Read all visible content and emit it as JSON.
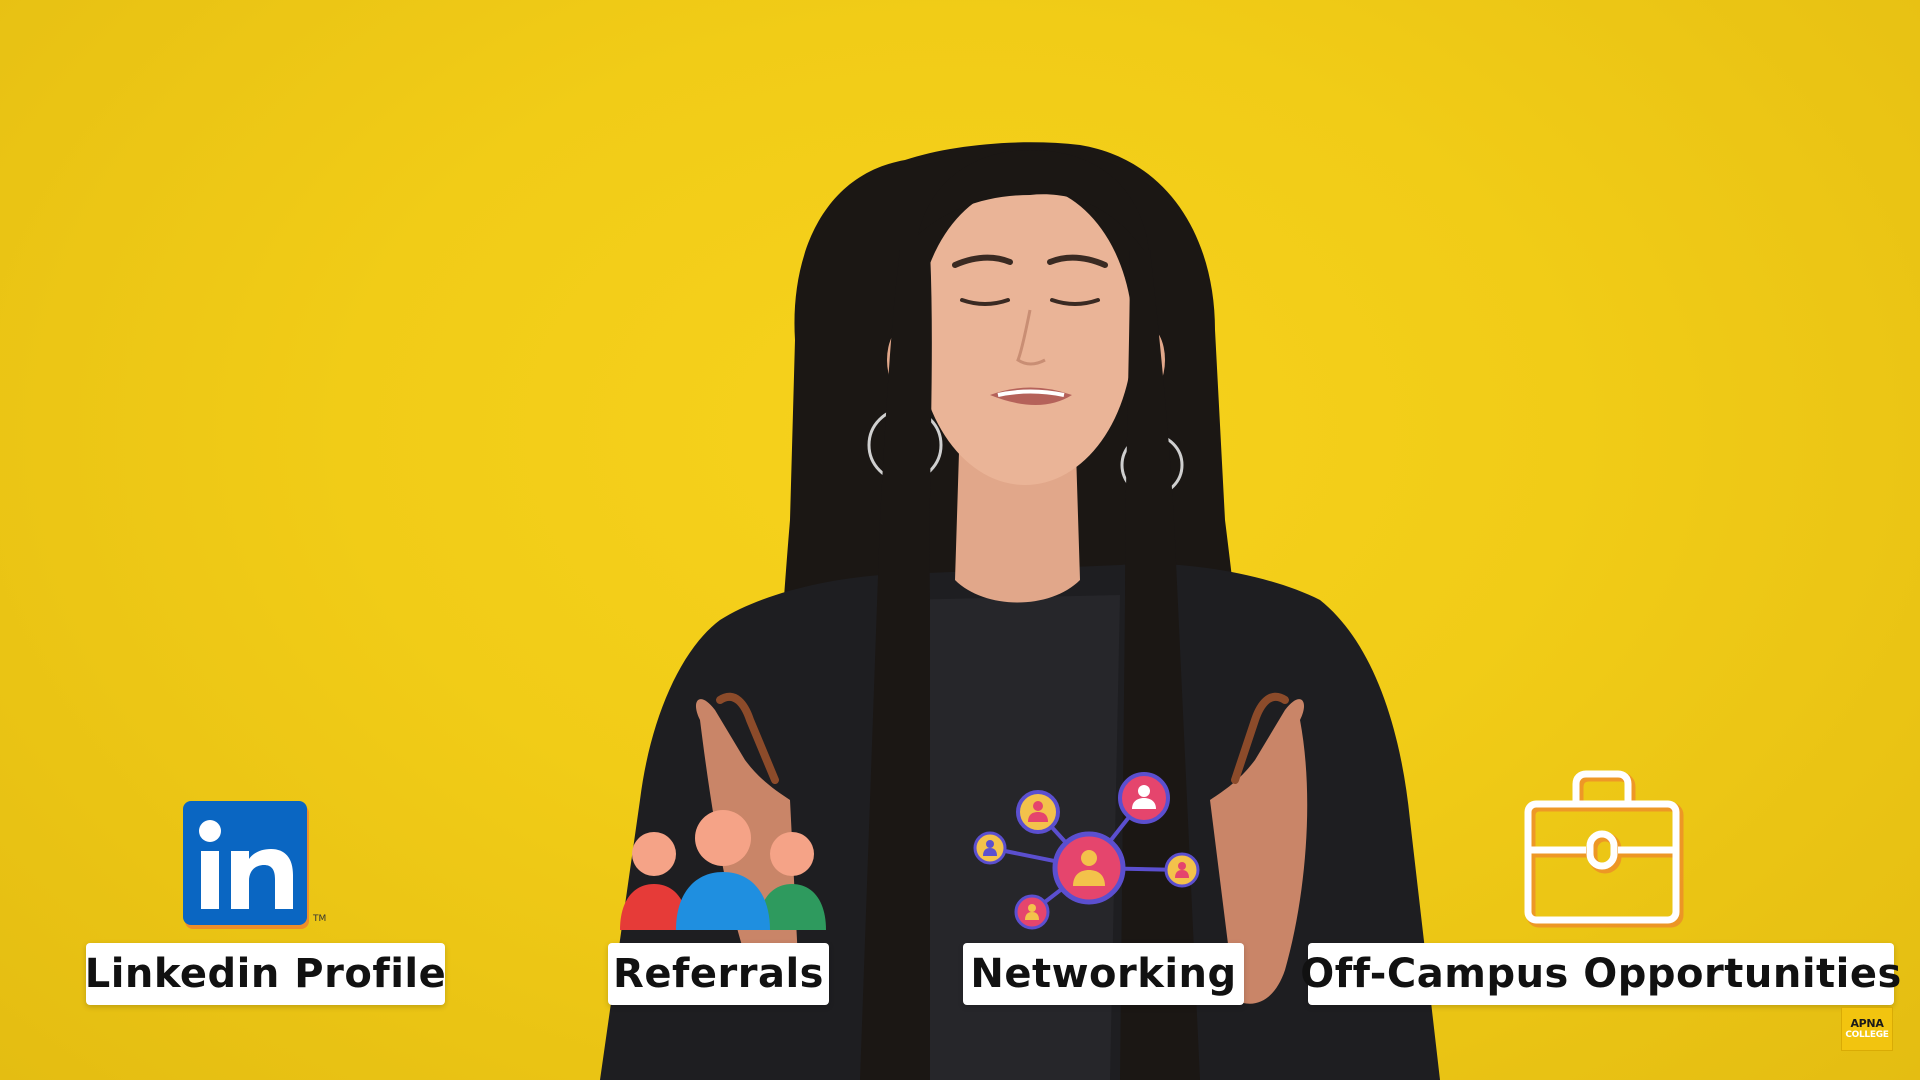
{
  "labels": {
    "linkedin": "Linkedin Profile",
    "referrals": "Referrals",
    "networking": "Networking",
    "offcampus": "Off-Campus Opportunities"
  },
  "linkedin_logo": {
    "text": "in",
    "trademark": "TM"
  },
  "watermark": {
    "line1": "APNA",
    "line2": "COLLEGE"
  },
  "colors": {
    "background": "#f1cc17",
    "linkedin_blue": "#0a66c2",
    "label_bg": "#ffffff",
    "label_text": "#111111",
    "icon_outline": "#ffffff",
    "icon_glow": "#f0603a"
  },
  "icons": [
    "linkedin-icon",
    "referrals-icon",
    "networking-icon",
    "briefcase-icon"
  ]
}
